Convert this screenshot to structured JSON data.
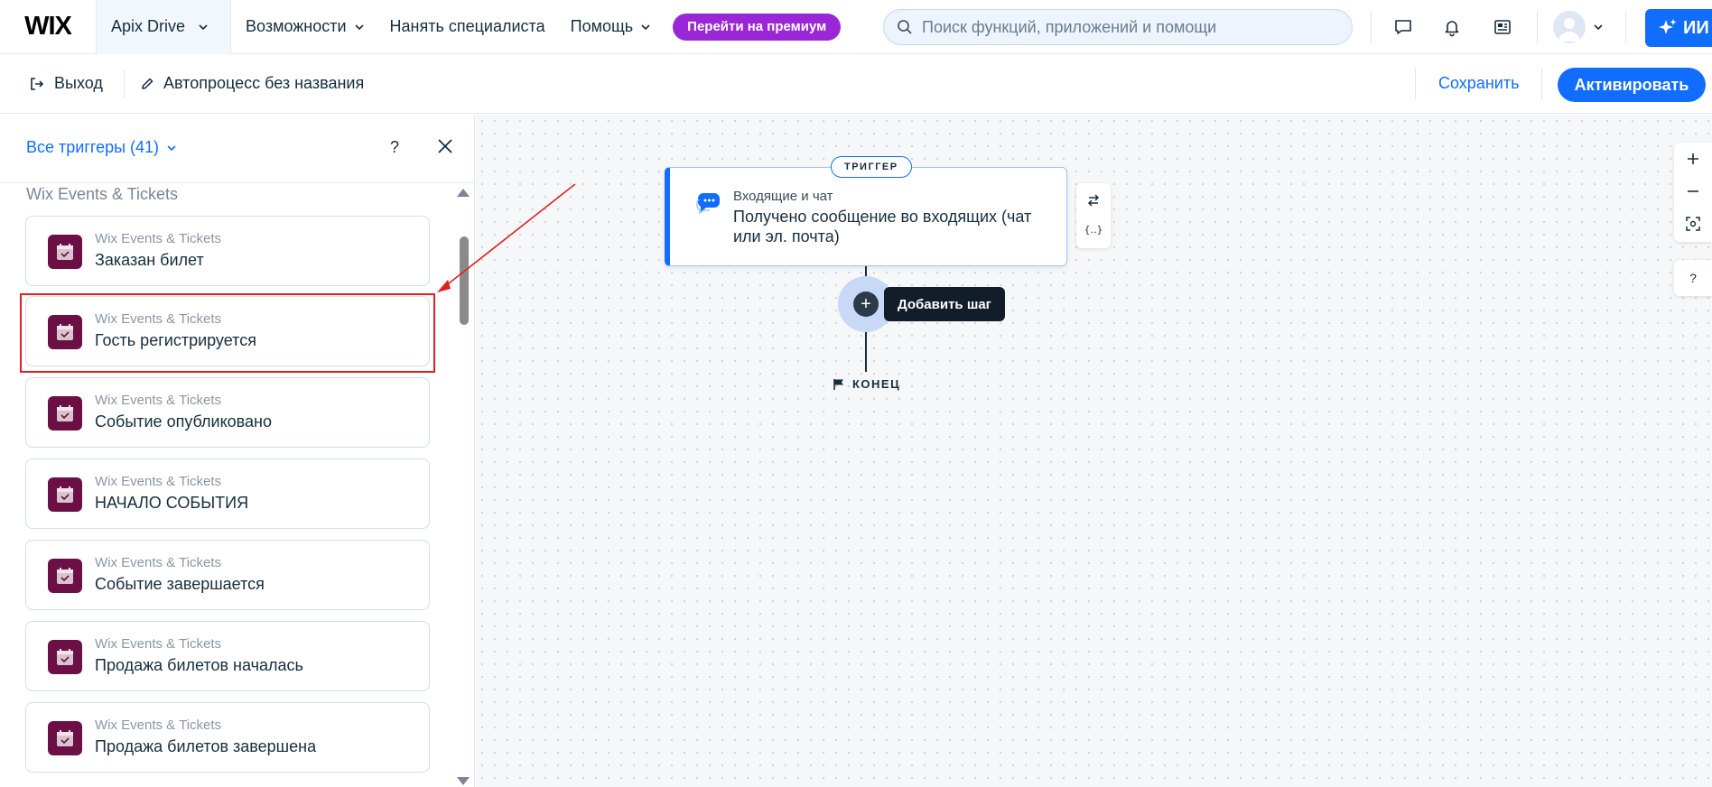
{
  "header": {
    "logo": "WIX",
    "site_name": "Apix Drive",
    "nav": [
      {
        "label": "Возможности",
        "has_dropdown": true
      },
      {
        "label": "Нанять специалиста",
        "has_dropdown": false
      },
      {
        "label": "Помощь",
        "has_dropdown": true
      }
    ],
    "premium_label": "Перейти на премиум",
    "search_placeholder": "Поиск функций, приложений и помощи",
    "ai_label": "ИИ"
  },
  "toolbar": {
    "exit_label": "Выход",
    "automation_title": "Автопроцесс без названия",
    "save_label": "Сохранить",
    "activate_label": "Активировать"
  },
  "panel": {
    "all_triggers_label": "Все триггеры (41)",
    "help_label": "?",
    "section_title": "Wix Events & Tickets",
    "items": [
      {
        "app": "Wix Events & Tickets",
        "name": "Заказан билет"
      },
      {
        "app": "Wix Events & Tickets",
        "name": "Гость регистрируется",
        "highlighted": true
      },
      {
        "app": "Wix Events & Tickets",
        "name": "Событие опубликовано"
      },
      {
        "app": "Wix Events & Tickets",
        "name": "НАЧАЛО СОБЫТИЯ"
      },
      {
        "app": "Wix Events & Tickets",
        "name": "Событие завершается"
      },
      {
        "app": "Wix Events & Tickets",
        "name": "Продажа билетов началась"
      },
      {
        "app": "Wix Events & Tickets",
        "name": "Продажа билетов завершена"
      }
    ]
  },
  "canvas": {
    "trigger_tag": "ТРИГГЕР",
    "trigger_category": "Входящие и чат",
    "trigger_text": "Получено сообщение во входящих (чат или эл. почта)",
    "add_step_tooltip": "Добавить шаг",
    "end_label": "КОНЕЦ",
    "help_label": "?"
  },
  "colors": {
    "accent": "#116dff",
    "premium": "#9a27d5",
    "event_icon": "#6b0f44",
    "highlight": "#e02020"
  }
}
